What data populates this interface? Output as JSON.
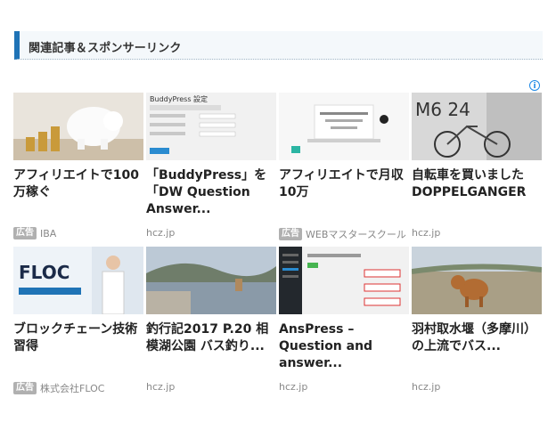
{
  "header": {
    "title": "関連記事＆スポンサーリンク"
  },
  "cards": [
    {
      "title": "アフィリエイトで100万稼ぐ",
      "badge": "広告",
      "source": "IBA",
      "thumb_icon": "piggy-bank-coins-image"
    },
    {
      "title": "「BuddyPress」を「DW Question Answer...",
      "badge": "",
      "source": "hcz.jp",
      "thumb_icon": "buddypress-settings-screenshot"
    },
    {
      "title": "アフィリエイトで月収10万",
      "badge": "広告",
      "source": "WEBマスタースクール",
      "thumb_icon": "laptop-desk-image"
    },
    {
      "title": "自転車を買いましたDOPPELGANGER",
      "badge": "",
      "source": "hcz.jp",
      "thumb_icon": "bicycle-image"
    },
    {
      "title": "ブロックチェーン技術習得",
      "badge": "広告",
      "source": "株式会社FLOC",
      "thumb_icon": "floc-presenter-image"
    },
    {
      "title": "釣行記2017 P.20 相模湖公園 バス釣り...",
      "badge": "",
      "source": "hcz.jp",
      "thumb_icon": "lake-landscape-image"
    },
    {
      "title": "AnsPress – Question and answer...",
      "badge": "",
      "source": "hcz.jp",
      "thumb_icon": "wordpress-admin-screenshot"
    },
    {
      "title": "羽村取水堰（多摩川）の上流でバス...",
      "badge": "",
      "source": "hcz.jp",
      "thumb_icon": "dog-riverbank-image"
    }
  ],
  "thumb_texts": {
    "buddypress_title": "BuddyPress 設定",
    "floc_logo": "FLOC",
    "bike_label": "M6 24"
  },
  "ad_info_icon": "info-icon",
  "colors": {
    "accent": "#1f73b6",
    "title": "#222222",
    "source": "#888888",
    "badge": "#b0b0b0"
  }
}
